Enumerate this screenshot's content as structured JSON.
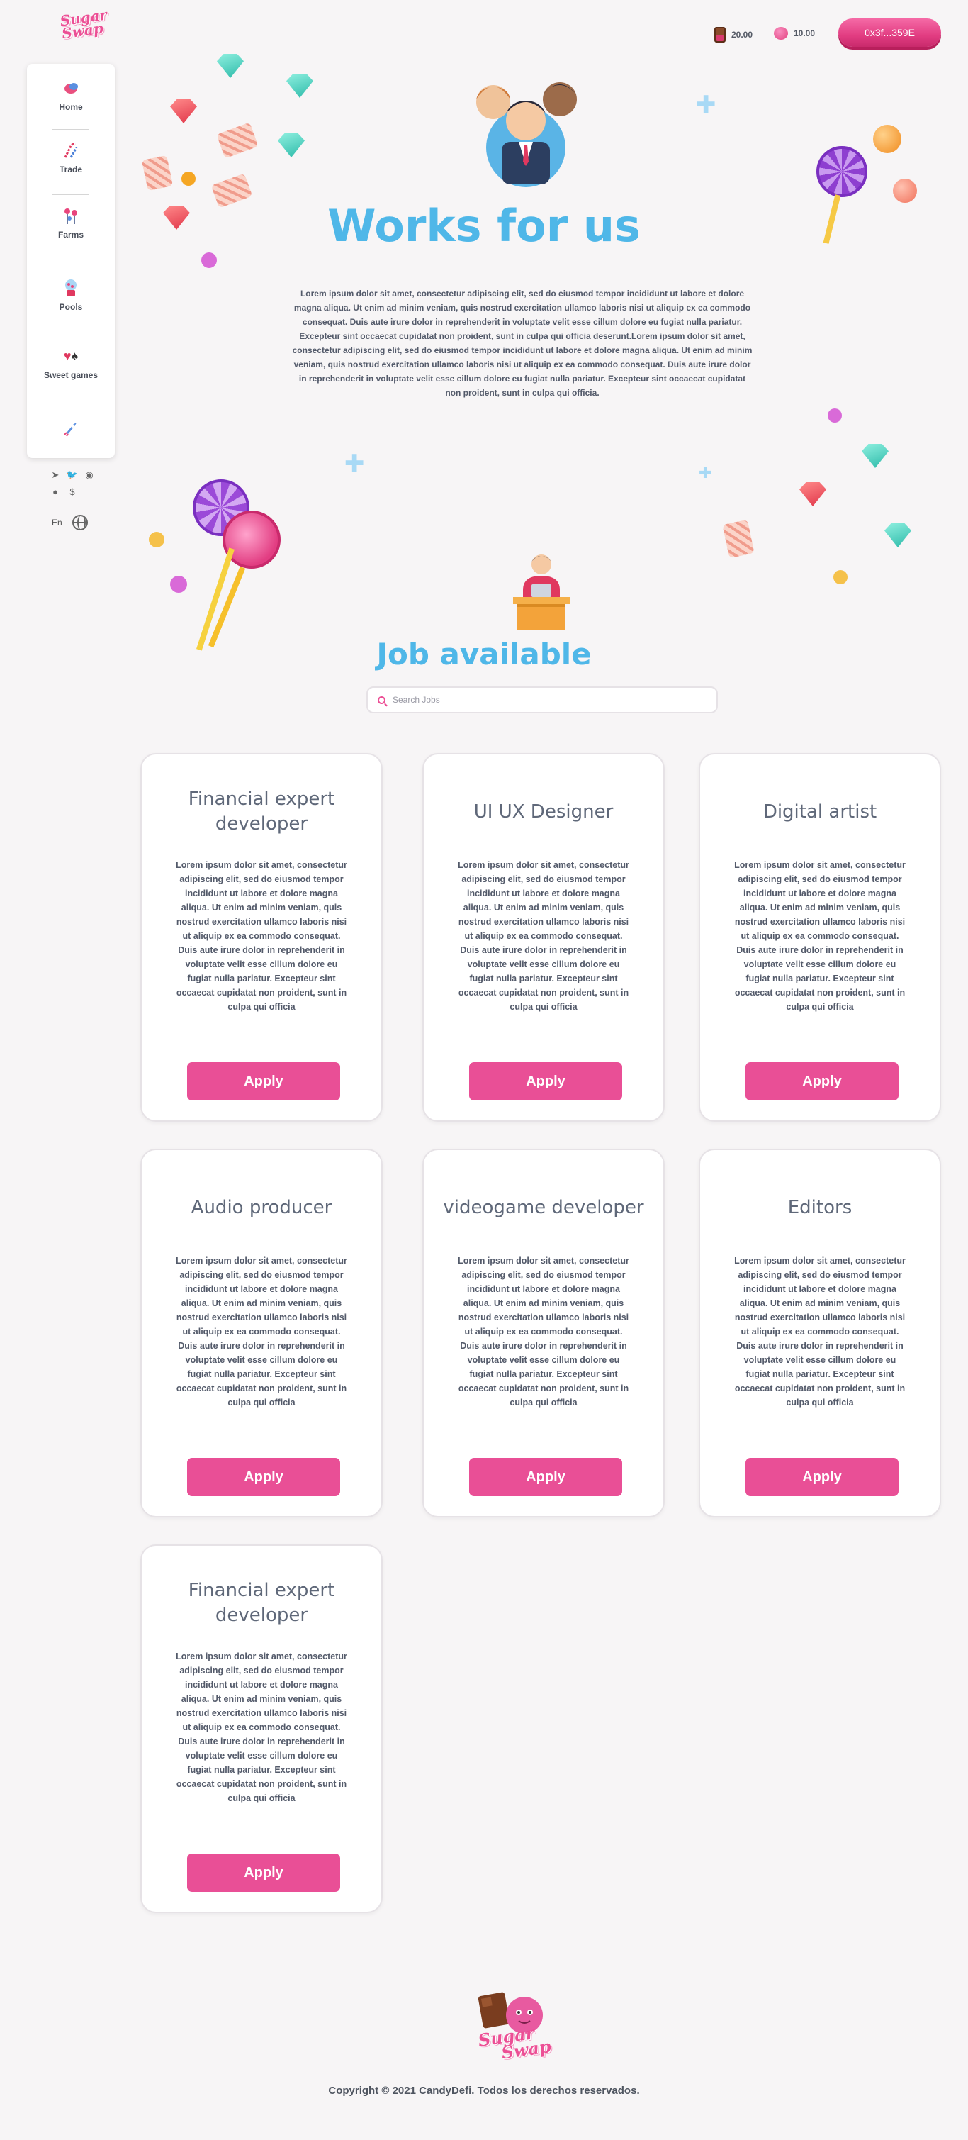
{
  "header": {
    "brand": "Sugar Swap",
    "balances": [
      {
        "icon": "chocolate-bar-icon",
        "value": "20.00"
      },
      {
        "icon": "pink-candy-icon",
        "value": "10.00"
      }
    ],
    "wallet_label": "0x3f...359E"
  },
  "sidebar": {
    "items": [
      {
        "label": "Home",
        "icon": "candy-home-icon"
      },
      {
        "label": "Trade",
        "icon": "candy-cane-icon"
      },
      {
        "label": "Farms",
        "icon": "candy-tree-icon"
      },
      {
        "label": "Pools",
        "icon": "gumball-machine-icon"
      },
      {
        "label": "Sweet games",
        "icon": "card-suits-icon"
      },
      {
        "label": "",
        "icon": "rocket-icon"
      }
    ],
    "social": [
      "telegram-icon",
      "twitter-icon",
      "reddit-icon",
      "github-icon",
      "coin-icon"
    ],
    "lang": "En"
  },
  "hero": {
    "title": "Works for us",
    "text": "Lorem ipsum dolor sit amet, consectetur adipiscing elit, sed do eiusmod tempor incididunt ut labore et dolore magna aliqua. Ut enim ad minim veniam, quis nostrud exercitation ullamco laboris nisi ut aliquip ex ea commodo consequat. Duis aute irure dolor in reprehenderit in voluptate velit esse cillum dolore eu fugiat nulla pariatur. Excepteur sint occaecat cupidatat non proident, sunt in culpa qui officia deserunt.Lorem ipsum dolor sit amet, consectetur adipiscing elit, sed do eiusmod tempor incididunt ut labore et dolore magna aliqua. Ut enim ad minim veniam, quis nostrud exercitation ullamco laboris nisi ut aliquip ex ea commodo consequat. Duis aute irure dolor in reprehenderit in voluptate velit esse cillum dolore eu fugiat nulla pariatur. Excepteur sint occaecat cupidatat non proident, sunt in culpa qui officia."
  },
  "jobs": {
    "title": "Job available",
    "search_placeholder": "Search Jobs",
    "apply_label": "Apply",
    "cards": [
      {
        "title": "Financial expert developer",
        "desc": "Lorem ipsum dolor sit amet, consectetur adipiscing elit, sed do eiusmod tempor incididunt ut labore et dolore magna aliqua. Ut enim ad minim veniam, quis nostrud exercitation ullamco laboris nisi ut aliquip ex ea commodo consequat. Duis aute irure dolor in reprehenderit in voluptate velit esse cillum dolore eu fugiat nulla pariatur. Excepteur sint occaecat cupidatat non proident, sunt in culpa qui officia"
      },
      {
        "title": "UI UX Designer",
        "desc": "Lorem ipsum dolor sit amet, consectetur adipiscing elit, sed do eiusmod tempor incididunt ut labore et dolore magna aliqua. Ut enim ad minim veniam, quis nostrud exercitation ullamco laboris nisi ut aliquip ex ea commodo consequat. Duis aute irure dolor in reprehenderit in voluptate velit esse cillum dolore eu fugiat nulla pariatur. Excepteur sint occaecat cupidatat non proident, sunt in culpa qui officia"
      },
      {
        "title": "Digital artist",
        "desc": "Lorem ipsum dolor sit amet, consectetur adipiscing elit, sed do eiusmod tempor incididunt ut labore et dolore magna aliqua. Ut enim ad minim veniam, quis nostrud exercitation ullamco laboris nisi ut aliquip ex ea commodo consequat. Duis aute irure dolor in reprehenderit in voluptate velit esse cillum dolore eu fugiat nulla pariatur. Excepteur sint occaecat cupidatat non proident, sunt in culpa qui officia"
      },
      {
        "title": "Audio producer",
        "desc": "Lorem ipsum dolor sit amet, consectetur adipiscing elit, sed do eiusmod tempor incididunt ut labore et dolore magna aliqua. Ut enim ad minim veniam, quis nostrud exercitation ullamco laboris nisi ut aliquip ex ea commodo consequat. Duis aute irure dolor in reprehenderit in voluptate velit esse cillum dolore eu fugiat nulla pariatur. Excepteur sint occaecat cupidatat non proident, sunt in culpa qui officia"
      },
      {
        "title": "videogame developer",
        "desc": "Lorem ipsum dolor sit amet, consectetur adipiscing elit, sed do eiusmod tempor incididunt ut labore et dolore magna aliqua. Ut enim ad minim veniam, quis nostrud exercitation ullamco laboris nisi ut aliquip ex ea commodo consequat. Duis aute irure dolor in reprehenderit in voluptate velit esse cillum dolore eu fugiat nulla pariatur. Excepteur sint occaecat cupidatat non proident, sunt in culpa qui officia"
      },
      {
        "title": "Editors",
        "desc": "Lorem ipsum dolor sit amet, consectetur adipiscing elit, sed do eiusmod tempor incididunt ut labore et dolore magna aliqua. Ut enim ad minim veniam, quis nostrud exercitation ullamco laboris nisi ut aliquip ex ea commodo consequat. Duis aute irure dolor in reprehenderit in voluptate velit esse cillum dolore eu fugiat nulla pariatur. Excepteur sint occaecat cupidatat non proident, sunt in culpa qui officia"
      },
      {
        "title": "Financial expert developer",
        "desc": "Lorem ipsum dolor sit amet, consectetur adipiscing elit, sed do eiusmod tempor incididunt ut labore et dolore magna aliqua. Ut enim ad minim veniam, quis nostrud exercitation ullamco laboris nisi ut aliquip ex ea commodo consequat. Duis aute irure dolor in reprehenderit in voluptate velit esse cillum dolore eu fugiat nulla pariatur. Excepteur sint occaecat cupidatat non proident, sunt in culpa qui officia"
      }
    ]
  },
  "footer": {
    "brand": "Sugar Swap",
    "copyright": "Copyright © 2021 CandyDefi. Todos los derechos reservados."
  },
  "colors": {
    "accent_pink": "#e94f96",
    "title_blue": "#4fb7e8",
    "background": "#f7f5f6"
  }
}
